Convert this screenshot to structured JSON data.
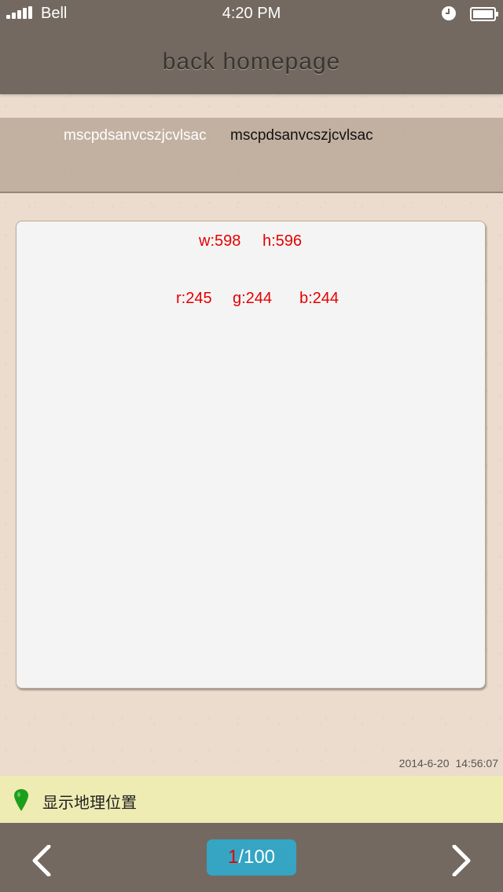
{
  "status_bar": {
    "carrier": "Bell",
    "time": "4:20 PM"
  },
  "nav": {
    "title": "back  homepage"
  },
  "info": {
    "left_text": "mscpdsanvcszjcvlsac",
    "right_text": "mscpdsanvcszjcvlsac"
  },
  "card": {
    "width_label": "w:598",
    "height_label": "h:596",
    "r_label": "r:245",
    "g_label": "g:244",
    "b_label": "b:244"
  },
  "timestamp": {
    "date": "2014-6-20",
    "time": "14:56:07"
  },
  "location": {
    "label": "显示地理位置",
    "icon": "map-pin-icon"
  },
  "pager": {
    "current": "1",
    "total": "/100"
  },
  "colors": {
    "header_bg": "#736960",
    "accent_red": "#e50000",
    "pager_bg": "#35a5c3",
    "location_bg": "#eeebb3",
    "pin_green": "#1aa01a"
  }
}
